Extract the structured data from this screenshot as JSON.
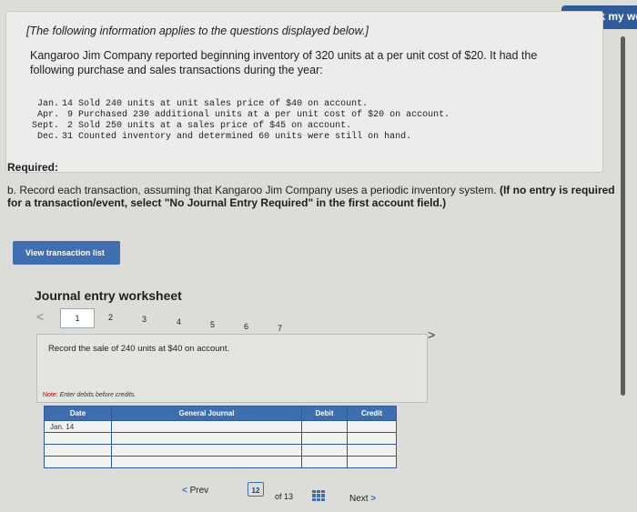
{
  "header": {
    "check_my_work": "Check my wo"
  },
  "info": {
    "note": "[The following information applies to the questions displayed below.]",
    "intro": "Kangaroo Jim Company reported beginning inventory of 320 units at a per unit cost of $20. It had the following purchase and sales transactions during the year:",
    "transactions": [
      {
        "month": "Jan.",
        "day": "14",
        "text": "Sold 240 units at unit sales price of $40 on account."
      },
      {
        "month": "Apr.",
        "day": "9",
        "text": "Purchased 230 additional units at a per unit cost of $20 on account."
      },
      {
        "month": "Sept.",
        "day": "2",
        "text": "Sold 250 units at a sales price of $45 on account."
      },
      {
        "month": "Dec.",
        "day": "31",
        "text": "Counted inventory and determined 60 units were still on hand."
      }
    ]
  },
  "required": {
    "label": "Required:",
    "question": "b. Record each transaction, assuming that Kangaroo Jim Company uses a periodic inventory system.",
    "instruction": "(If no entry is required for a transaction/event, select \"No Journal Entry Required\" in the first account field.)"
  },
  "view_transaction_list": "View transaction list",
  "worksheet": {
    "title": "Journal entry worksheet",
    "steps": [
      "1",
      "2",
      "3",
      "4",
      "5",
      "6",
      "7"
    ],
    "task": "Record the sale of 240 units at $40 on account.",
    "note_label": "Note:",
    "note_text": "Enter debits before credits.",
    "columns": {
      "date": "Date",
      "general_journal": "General Journal",
      "debit": "Debit",
      "credit": "Credit"
    },
    "first_date": "Jan. 14"
  },
  "pagination": {
    "prev": "Prev",
    "current": "12",
    "of_total": "of 13",
    "next": "Next"
  }
}
